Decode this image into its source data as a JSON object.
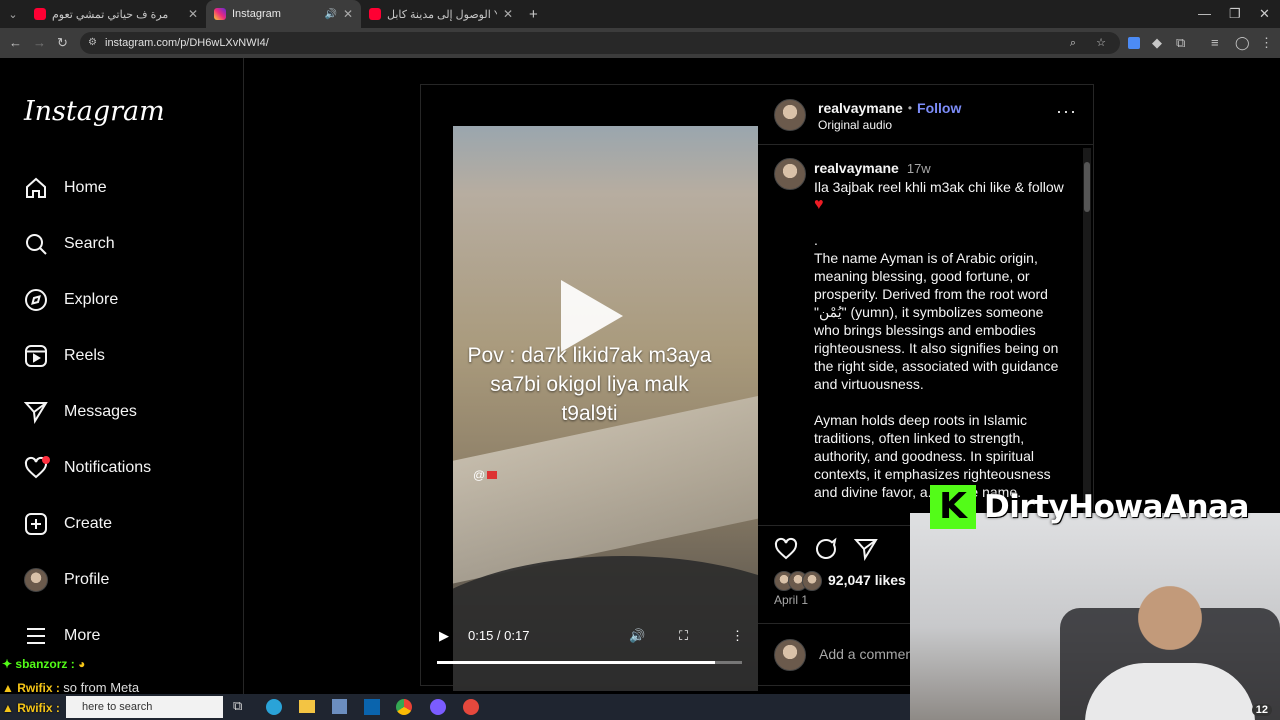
{
  "browser": {
    "tabs": [
      {
        "title": "أول مرة ف حياتي تمشي تعوم",
        "active": false
      },
      {
        "title": "Instagram",
        "active": true
      },
      {
        "title": "الوصول إلى مدينة كابل YouTube",
        "active": false
      }
    ],
    "url": "instagram.com/p/DH6wLXvNWI4/"
  },
  "sidebar": {
    "logo": "Instagram",
    "items": [
      {
        "label": "Home",
        "icon": "home-icon"
      },
      {
        "label": "Search",
        "icon": "search-icon"
      },
      {
        "label": "Explore",
        "icon": "compass-icon"
      },
      {
        "label": "Reels",
        "icon": "reels-icon"
      },
      {
        "label": "Messages",
        "icon": "send-icon"
      },
      {
        "label": "Notifications",
        "icon": "heart-icon"
      },
      {
        "label": "Create",
        "icon": "plus-square-icon"
      },
      {
        "label": "Profile",
        "icon": "avatar-icon"
      },
      {
        "label": "More",
        "icon": "menu-icon"
      }
    ]
  },
  "video": {
    "caption_lines": [
      "Pov : da7k likid7ak m3aya",
      "sa7bi okigol liya malk",
      "t9al9ti"
    ],
    "watermark": "@",
    "time": "0:15 / 0:17",
    "progress": 0.91
  },
  "post": {
    "username": "realvaymane",
    "follow_sep": "•",
    "follow_label": "Follow",
    "audio": "Original audio",
    "comment_username": "realvaymane",
    "comment_age": "17w",
    "caption_line1": "Ila 3ajbak reel khli m3ak chi like & follow",
    "caption_body": ".\nThe name Ayman is of Arabic origin, meaning blessing, good fortune, or prosperity. Derived from the root word \"يُمْن\" (yumn), it symbolizes someone who brings blessings and embodies righteousness. It also signifies being on the right side, associated with guidance and virtuousness.\n\nAyman holds deep roots in Islamic traditions, often linked to strength, authority, and goodness. In spiritual contexts, it emphasizes righteousness and divine favor, a... to the name.",
    "likes": "92,047 likes",
    "date": "April 1",
    "comment_placeholder": "Add a comment..."
  },
  "overlay": {
    "stream_name": "DirtyHowaAnaa",
    "kick_letter": "K",
    "chat": [
      {
        "user": "sbanzorz :",
        "color": "#53fc18"
      },
      {
        "user": "Rwifix :",
        "color": "#f5c518"
      },
      {
        "user": "Rwifix :",
        "color": "#f5c518"
      }
    ],
    "meta_text": "so from Meta",
    "taskbar_search": "here to search",
    "badge_count": "12"
  }
}
